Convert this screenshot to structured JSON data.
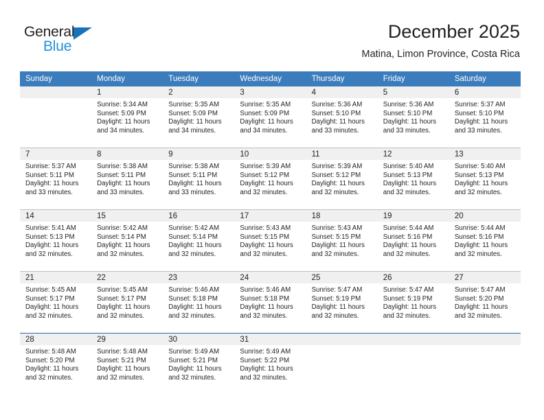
{
  "logo": {
    "word_top": "General",
    "word_bottom": "Blue",
    "triangle_color": "#1673bc",
    "blue_color": "#1f8fdc",
    "dark_color": "#231f20"
  },
  "header": {
    "title": "December 2025",
    "subtitle": "Matina, Limon Province, Costa Rica"
  },
  "theme": {
    "header_blue": "#3b7cbd",
    "day_band_gray": "#f0f0f0",
    "week_rule_gray": "#bfbfbf",
    "week_rule_blue": "#2b6cad",
    "text": "#231f20"
  },
  "weekday_headers": [
    "Sunday",
    "Monday",
    "Tuesday",
    "Wednesday",
    "Thursday",
    "Friday",
    "Saturday"
  ],
  "weeks": [
    {
      "rule": "none",
      "days": [
        {
          "date": "",
          "empty": true,
          "sunrise": "",
          "sunset": "",
          "daylight_line1": "",
          "daylight_line2": ""
        },
        {
          "date": "1",
          "empty": false,
          "sunrise": "Sunrise: 5:34 AM",
          "sunset": "Sunset: 5:09 PM",
          "daylight_line1": "Daylight: 11 hours",
          "daylight_line2": "and 34 minutes."
        },
        {
          "date": "2",
          "empty": false,
          "sunrise": "Sunrise: 5:35 AM",
          "sunset": "Sunset: 5:09 PM",
          "daylight_line1": "Daylight: 11 hours",
          "daylight_line2": "and 34 minutes."
        },
        {
          "date": "3",
          "empty": false,
          "sunrise": "Sunrise: 5:35 AM",
          "sunset": "Sunset: 5:09 PM",
          "daylight_line1": "Daylight: 11 hours",
          "daylight_line2": "and 34 minutes."
        },
        {
          "date": "4",
          "empty": false,
          "sunrise": "Sunrise: 5:36 AM",
          "sunset": "Sunset: 5:10 PM",
          "daylight_line1": "Daylight: 11 hours",
          "daylight_line2": "and 33 minutes."
        },
        {
          "date": "5",
          "empty": false,
          "sunrise": "Sunrise: 5:36 AM",
          "sunset": "Sunset: 5:10 PM",
          "daylight_line1": "Daylight: 11 hours",
          "daylight_line2": "and 33 minutes."
        },
        {
          "date": "6",
          "empty": false,
          "sunrise": "Sunrise: 5:37 AM",
          "sunset": "Sunset: 5:10 PM",
          "daylight_line1": "Daylight: 11 hours",
          "daylight_line2": "and 33 minutes."
        }
      ]
    },
    {
      "rule": "gray",
      "days": [
        {
          "date": "7",
          "empty": false,
          "sunrise": "Sunrise: 5:37 AM",
          "sunset": "Sunset: 5:11 PM",
          "daylight_line1": "Daylight: 11 hours",
          "daylight_line2": "and 33 minutes."
        },
        {
          "date": "8",
          "empty": false,
          "sunrise": "Sunrise: 5:38 AM",
          "sunset": "Sunset: 5:11 PM",
          "daylight_line1": "Daylight: 11 hours",
          "daylight_line2": "and 33 minutes."
        },
        {
          "date": "9",
          "empty": false,
          "sunrise": "Sunrise: 5:38 AM",
          "sunset": "Sunset: 5:11 PM",
          "daylight_line1": "Daylight: 11 hours",
          "daylight_line2": "and 33 minutes."
        },
        {
          "date": "10",
          "empty": false,
          "sunrise": "Sunrise: 5:39 AM",
          "sunset": "Sunset: 5:12 PM",
          "daylight_line1": "Daylight: 11 hours",
          "daylight_line2": "and 32 minutes."
        },
        {
          "date": "11",
          "empty": false,
          "sunrise": "Sunrise: 5:39 AM",
          "sunset": "Sunset: 5:12 PM",
          "daylight_line1": "Daylight: 11 hours",
          "daylight_line2": "and 32 minutes."
        },
        {
          "date": "12",
          "empty": false,
          "sunrise": "Sunrise: 5:40 AM",
          "sunset": "Sunset: 5:13 PM",
          "daylight_line1": "Daylight: 11 hours",
          "daylight_line2": "and 32 minutes."
        },
        {
          "date": "13",
          "empty": false,
          "sunrise": "Sunrise: 5:40 AM",
          "sunset": "Sunset: 5:13 PM",
          "daylight_line1": "Daylight: 11 hours",
          "daylight_line2": "and 32 minutes."
        }
      ]
    },
    {
      "rule": "gray",
      "days": [
        {
          "date": "14",
          "empty": false,
          "sunrise": "Sunrise: 5:41 AM",
          "sunset": "Sunset: 5:13 PM",
          "daylight_line1": "Daylight: 11 hours",
          "daylight_line2": "and 32 minutes."
        },
        {
          "date": "15",
          "empty": false,
          "sunrise": "Sunrise: 5:42 AM",
          "sunset": "Sunset: 5:14 PM",
          "daylight_line1": "Daylight: 11 hours",
          "daylight_line2": "and 32 minutes."
        },
        {
          "date": "16",
          "empty": false,
          "sunrise": "Sunrise: 5:42 AM",
          "sunset": "Sunset: 5:14 PM",
          "daylight_line1": "Daylight: 11 hours",
          "daylight_line2": "and 32 minutes."
        },
        {
          "date": "17",
          "empty": false,
          "sunrise": "Sunrise: 5:43 AM",
          "sunset": "Sunset: 5:15 PM",
          "daylight_line1": "Daylight: 11 hours",
          "daylight_line2": "and 32 minutes."
        },
        {
          "date": "18",
          "empty": false,
          "sunrise": "Sunrise: 5:43 AM",
          "sunset": "Sunset: 5:15 PM",
          "daylight_line1": "Daylight: 11 hours",
          "daylight_line2": "and 32 minutes."
        },
        {
          "date": "19",
          "empty": false,
          "sunrise": "Sunrise: 5:44 AM",
          "sunset": "Sunset: 5:16 PM",
          "daylight_line1": "Daylight: 11 hours",
          "daylight_line2": "and 32 minutes."
        },
        {
          "date": "20",
          "empty": false,
          "sunrise": "Sunrise: 5:44 AM",
          "sunset": "Sunset: 5:16 PM",
          "daylight_line1": "Daylight: 11 hours",
          "daylight_line2": "and 32 minutes."
        }
      ]
    },
    {
      "rule": "gray",
      "days": [
        {
          "date": "21",
          "empty": false,
          "sunrise": "Sunrise: 5:45 AM",
          "sunset": "Sunset: 5:17 PM",
          "daylight_line1": "Daylight: 11 hours",
          "daylight_line2": "and 32 minutes."
        },
        {
          "date": "22",
          "empty": false,
          "sunrise": "Sunrise: 5:45 AM",
          "sunset": "Sunset: 5:17 PM",
          "daylight_line1": "Daylight: 11 hours",
          "daylight_line2": "and 32 minutes."
        },
        {
          "date": "23",
          "empty": false,
          "sunrise": "Sunrise: 5:46 AM",
          "sunset": "Sunset: 5:18 PM",
          "daylight_line1": "Daylight: 11 hours",
          "daylight_line2": "and 32 minutes."
        },
        {
          "date": "24",
          "empty": false,
          "sunrise": "Sunrise: 5:46 AM",
          "sunset": "Sunset: 5:18 PM",
          "daylight_line1": "Daylight: 11 hours",
          "daylight_line2": "and 32 minutes."
        },
        {
          "date": "25",
          "empty": false,
          "sunrise": "Sunrise: 5:47 AM",
          "sunset": "Sunset: 5:19 PM",
          "daylight_line1": "Daylight: 11 hours",
          "daylight_line2": "and 32 minutes."
        },
        {
          "date": "26",
          "empty": false,
          "sunrise": "Sunrise: 5:47 AM",
          "sunset": "Sunset: 5:19 PM",
          "daylight_line1": "Daylight: 11 hours",
          "daylight_line2": "and 32 minutes."
        },
        {
          "date": "27",
          "empty": false,
          "sunrise": "Sunrise: 5:47 AM",
          "sunset": "Sunset: 5:20 PM",
          "daylight_line1": "Daylight: 11 hours",
          "daylight_line2": "and 32 minutes."
        }
      ]
    },
    {
      "rule": "blue",
      "days": [
        {
          "date": "28",
          "empty": false,
          "sunrise": "Sunrise: 5:48 AM",
          "sunset": "Sunset: 5:20 PM",
          "daylight_line1": "Daylight: 11 hours",
          "daylight_line2": "and 32 minutes."
        },
        {
          "date": "29",
          "empty": false,
          "sunrise": "Sunrise: 5:48 AM",
          "sunset": "Sunset: 5:21 PM",
          "daylight_line1": "Daylight: 11 hours",
          "daylight_line2": "and 32 minutes."
        },
        {
          "date": "30",
          "empty": false,
          "sunrise": "Sunrise: 5:49 AM",
          "sunset": "Sunset: 5:21 PM",
          "daylight_line1": "Daylight: 11 hours",
          "daylight_line2": "and 32 minutes."
        },
        {
          "date": "31",
          "empty": false,
          "sunrise": "Sunrise: 5:49 AM",
          "sunset": "Sunset: 5:22 PM",
          "daylight_line1": "Daylight: 11 hours",
          "daylight_line2": "and 32 minutes."
        },
        {
          "date": "",
          "empty": true,
          "sunrise": "",
          "sunset": "",
          "daylight_line1": "",
          "daylight_line2": ""
        },
        {
          "date": "",
          "empty": true,
          "sunrise": "",
          "sunset": "",
          "daylight_line1": "",
          "daylight_line2": ""
        },
        {
          "date": "",
          "empty": true,
          "sunrise": "",
          "sunset": "",
          "daylight_line1": "",
          "daylight_line2": ""
        }
      ]
    }
  ]
}
